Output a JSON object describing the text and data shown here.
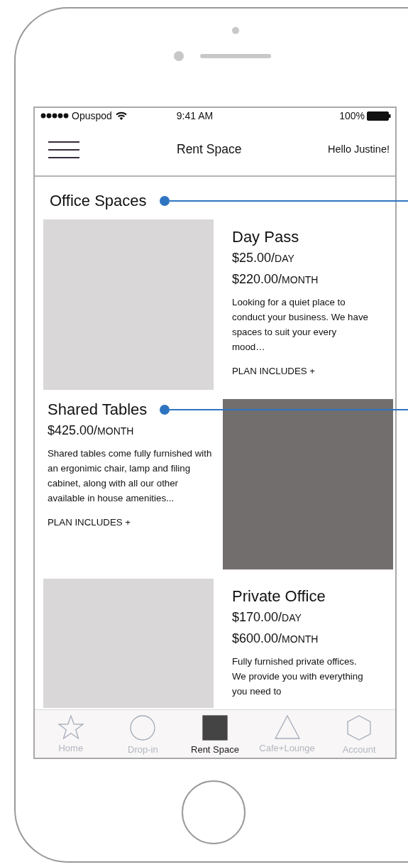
{
  "status_bar": {
    "carrier": "Opuspod",
    "time": "9:41 AM",
    "battery": "100%"
  },
  "nav_bar": {
    "title": "Rent Space",
    "greeting": "Hello Justine!"
  },
  "section": {
    "title": "Office Spaces",
    "annotated": true
  },
  "plans": [
    {
      "title": "Day Pass",
      "annotated": false,
      "kind": "image-left",
      "prices": [
        {
          "amount": "$25.00/",
          "unit": "DAY"
        },
        {
          "amount": "$220.00/",
          "unit": "MONTH"
        }
      ],
      "description": "Looking for a quiet place to conduct your business. We have spaces to suit your every mood…",
      "link": "PLAN INCLUDES +"
    },
    {
      "title": "Shared Tables",
      "annotated": true,
      "kind": "image-right",
      "prices": [
        {
          "amount": "$425.00/",
          "unit": "MONTH"
        }
      ],
      "description": "Shared tables come fully furnished with an ergonimic chair, lamp and filing cabinet, along with all our other available in house amenities...",
      "link": "PLAN INCLUDES +"
    },
    {
      "title": "Private Office",
      "annotated": false,
      "kind": "image-left",
      "prices": [
        {
          "amount": "$170.00/",
          "unit": "DAY"
        },
        {
          "amount": "$600.00/",
          "unit": "MONTH"
        }
      ],
      "description": "Fully furnished private offices. We provide you with everything you need to"
    }
  ],
  "tab_bar": [
    {
      "label": "Home",
      "kind": "star",
      "selected": false
    },
    {
      "label": "Drop-in",
      "kind": "circle",
      "selected": false
    },
    {
      "label": "Rent Space",
      "kind": "square",
      "selected": true
    },
    {
      "label": "Cafe+Lounge",
      "kind": "triangle",
      "selected": false
    },
    {
      "label": "Account",
      "kind": "hexagon",
      "selected": false
    }
  ]
}
